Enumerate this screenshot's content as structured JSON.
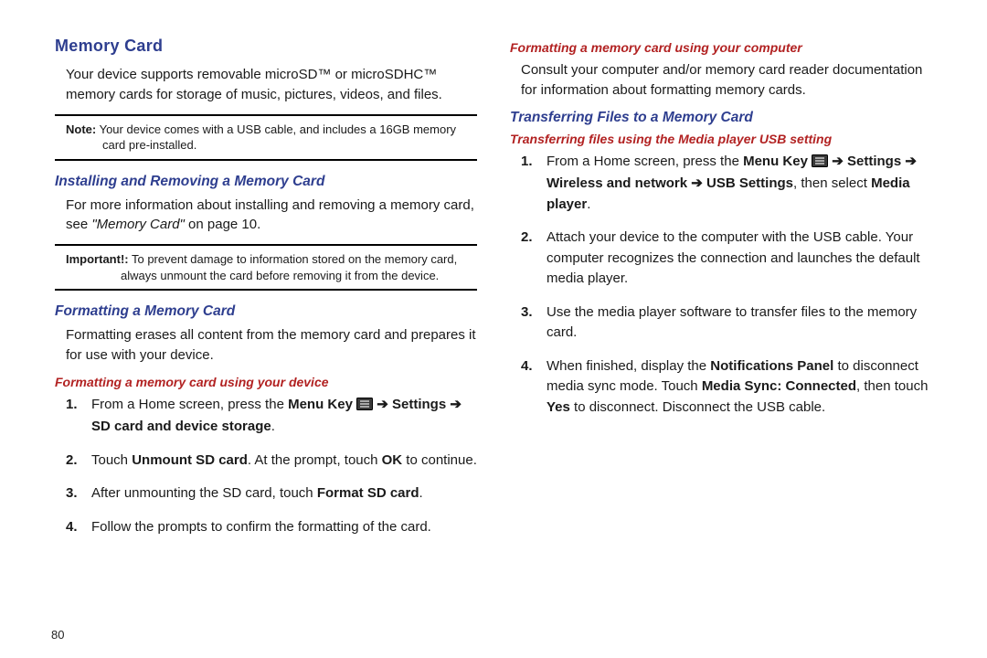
{
  "pageNumber": "80",
  "left": {
    "title": "Memory Card",
    "intro": "Your device supports removable microSD™ or microSDHC™ memory cards for storage of music, pictures, videos, and files.",
    "note": {
      "lead": "Note:",
      "line1": " Your device comes with a USB cable, and includes a 16GB memory",
      "line2": "card pre-installed."
    },
    "install": {
      "heading": "Installing and Removing a Memory Card",
      "body_pre": "For more information about installing and removing a memory card, see ",
      "body_quote": "\"Memory Card\"",
      "body_post": " on page 10."
    },
    "important": {
      "lead": "Important!:",
      "line1": " To prevent damage to information stored on the memory card,",
      "line2": "always unmount the card before removing it from the device."
    },
    "format": {
      "heading": "Formatting a Memory Card",
      "body": "Formatting erases all content from the memory card and prepares it for use with your device.",
      "sub": "Formatting a memory card using your device",
      "steps": {
        "s1_pre": "From a Home screen, press the ",
        "s1_menukey": "Menu Key",
        "s1_arrow1": " ➔ ",
        "s1_settings": "Settings",
        "s1_arrow2": " ➔ ",
        "s1_sd": "SD card and device storage",
        "s1_end": ".",
        "s2_pre": "Touch ",
        "s2_unmount": "Unmount SD card",
        "s2_mid": ". At the prompt, touch ",
        "s2_ok": "OK",
        "s2_end": " to continue.",
        "s3_pre": "After unmounting the SD card, touch ",
        "s3_format": "Format SD card",
        "s3_end": ".",
        "s4": "Follow the prompts to confirm the formatting of the card."
      }
    }
  },
  "right": {
    "sub1": "Formatting a memory card using your computer",
    "body1": "Consult your computer and/or memory card reader documentation for information about formatting memory cards.",
    "transfer": {
      "heading": "Transferring Files to a Memory Card",
      "sub": "Transferring files using the Media player USB setting",
      "steps": {
        "s1_pre": "From a Home screen, press the ",
        "s1_menukey": "Menu Key",
        "s1_arrow1": " ➔ ",
        "s1_settings": "Settings",
        "s1_arrow2": " ➔ ",
        "s1_wireless": "Wireless and network",
        "s1_arrow3": " ➔ ",
        "s1_usb": "USB Settings",
        "s1_mid": ", then select ",
        "s1_media": "Media player",
        "s1_end": ".",
        "s2": "Attach your device to the computer with the USB cable. Your computer recognizes the connection and launches the default media player.",
        "s3": "Use the media player software to transfer files to the memory card.",
        "s4_pre": "When finished, display the ",
        "s4_notif": "Notifications Panel",
        "s4_mid1": " to disconnect media sync mode. Touch ",
        "s4_sync": "Media Sync: Connected",
        "s4_mid2": ", then touch ",
        "s4_yes": "Yes",
        "s4_end": " to disconnect. Disconnect the USB cable."
      }
    }
  }
}
